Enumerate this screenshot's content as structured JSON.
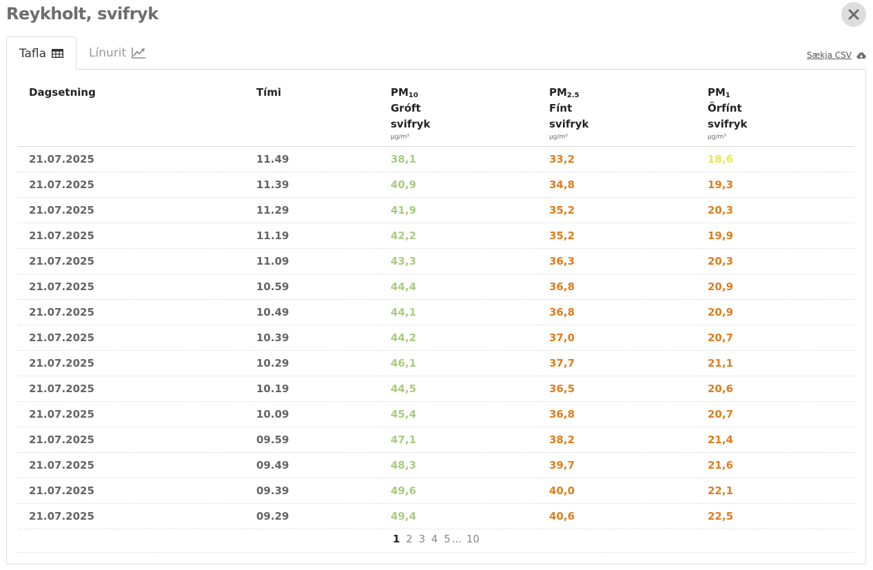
{
  "header": {
    "title": "Reykholt, svifryk"
  },
  "tabs": [
    {
      "label": "Tafla",
      "icon": "table-icon",
      "active": true
    },
    {
      "label": "Línurit",
      "icon": "line-chart-icon",
      "active": false
    }
  ],
  "download": {
    "label": "Sækja CSV",
    "icon": "cloud-download-icon"
  },
  "table": {
    "columns": {
      "date": "Dagsetning",
      "time": "Tími",
      "pm10": {
        "symbol": "PM",
        "sub": "10",
        "line1": "Gróft",
        "line2": "svifryk",
        "unit": "µg/m³"
      },
      "pm25": {
        "symbol": "PM",
        "sub": "2.5",
        "line1": "Fínt",
        "line2": "svifryk",
        "unit": "µg/m³"
      },
      "pm1": {
        "symbol": "PM",
        "sub": "1",
        "line1": "Örfínt",
        "line2": "svifryk",
        "unit": "µg/m³"
      }
    },
    "rows": [
      [
        "21.07.2025",
        "11.49",
        "38,1",
        "33,2",
        "18,6"
      ],
      [
        "21.07.2025",
        "11.39",
        "40,9",
        "34,8",
        "19,3"
      ],
      [
        "21.07.2025",
        "11.29",
        "41,9",
        "35,2",
        "20,3"
      ],
      [
        "21.07.2025",
        "11.19",
        "42,2",
        "35,2",
        "19,9"
      ],
      [
        "21.07.2025",
        "11.09",
        "43,3",
        "36,3",
        "20,3"
      ],
      [
        "21.07.2025",
        "10.59",
        "44,4",
        "36,8",
        "20,9"
      ],
      [
        "21.07.2025",
        "10.49",
        "44,1",
        "36,8",
        "20,9"
      ],
      [
        "21.07.2025",
        "10.39",
        "44,2",
        "37,0",
        "20,7"
      ],
      [
        "21.07.2025",
        "10.29",
        "46,1",
        "37,7",
        "21,1"
      ],
      [
        "21.07.2025",
        "10.19",
        "44,5",
        "36,5",
        "20,6"
      ],
      [
        "21.07.2025",
        "10.09",
        "45,4",
        "36,8",
        "20,7"
      ],
      [
        "21.07.2025",
        "09.59",
        "47,1",
        "38,2",
        "21,4"
      ],
      [
        "21.07.2025",
        "09.49",
        "48,3",
        "39,7",
        "21,6"
      ],
      [
        "21.07.2025",
        "09.39",
        "49,6",
        "40,0",
        "22,1"
      ],
      [
        "21.07.2025",
        "09.29",
        "49,4",
        "40,6",
        "22,5"
      ]
    ],
    "row_colors": [
      [
        "gray",
        "gray",
        "green",
        "orange",
        "yellow"
      ],
      [
        "gray",
        "gray",
        "green",
        "orange",
        "orange"
      ],
      [
        "gray",
        "gray",
        "green",
        "orange",
        "orange"
      ],
      [
        "gray",
        "gray",
        "green",
        "orange",
        "orange"
      ],
      [
        "gray",
        "gray",
        "green",
        "orange",
        "orange"
      ],
      [
        "gray",
        "gray",
        "green",
        "orange",
        "orange"
      ],
      [
        "gray",
        "gray",
        "green",
        "orange",
        "orange"
      ],
      [
        "gray",
        "gray",
        "green",
        "orange",
        "orange"
      ],
      [
        "gray",
        "gray",
        "green",
        "orange",
        "orange"
      ],
      [
        "gray",
        "gray",
        "green",
        "orange",
        "orange"
      ],
      [
        "gray",
        "gray",
        "green",
        "orange",
        "orange"
      ],
      [
        "gray",
        "gray",
        "green",
        "orange",
        "orange"
      ],
      [
        "gray",
        "gray",
        "green",
        "orange",
        "orange"
      ],
      [
        "gray",
        "gray",
        "green",
        "orange",
        "orange"
      ],
      [
        "gray",
        "gray",
        "green",
        "orange",
        "orange"
      ]
    ]
  },
  "pagination": {
    "pages": [
      "1",
      "2",
      "3",
      "4",
      "5"
    ],
    "ellipsis": "...",
    "last": "10",
    "current": "1"
  },
  "colors": {
    "green": "#a9cb7f",
    "orange": "#e07c1b",
    "yellow": "#e9e84b",
    "gray": "#646464"
  }
}
